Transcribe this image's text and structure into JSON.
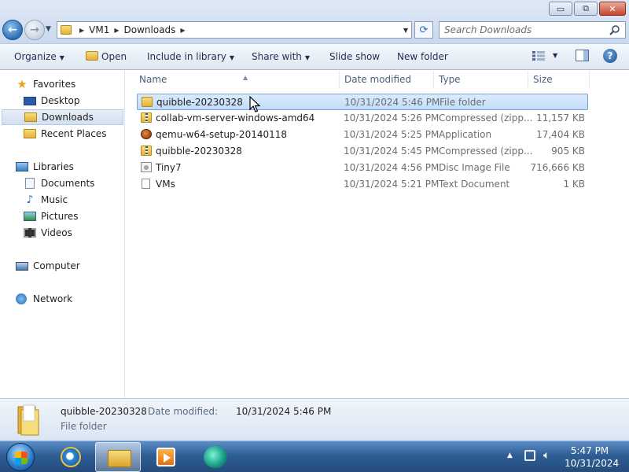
{
  "window": {
    "minimize_label": "▭",
    "maximize_label": "⧉",
    "close_label": "✕"
  },
  "nav": {
    "back_icon": "back-arrow-icon",
    "forward_icon": "forward-arrow-icon"
  },
  "address": {
    "crumbs": [
      "VM1",
      "Downloads"
    ]
  },
  "search": {
    "placeholder": "Search Downloads"
  },
  "toolbar": {
    "organize": "Organize",
    "open": "Open",
    "include_in_library": "Include in library",
    "share_with": "Share with",
    "slide_show": "Slide show",
    "new_folder": "New folder"
  },
  "sidebar": {
    "favorites": "Favorites",
    "desktop": "Desktop",
    "downloads": "Downloads",
    "recent_places": "Recent Places",
    "libraries": "Libraries",
    "documents": "Documents",
    "music": "Music",
    "pictures": "Pictures",
    "videos": "Videos",
    "computer": "Computer",
    "network": "Network"
  },
  "columns": {
    "name": "Name",
    "date_modified": "Date modified",
    "type": "Type",
    "size": "Size"
  },
  "files": [
    {
      "name": "quibble-20230328",
      "date": "10/31/2024 5:46 PM",
      "type": "File folder",
      "size": "",
      "icon": "folder-icon"
    },
    {
      "name": "collab-vm-server-windows-amd64",
      "date": "10/31/2024 5:26 PM",
      "type": "Compressed (zipp...",
      "size": "11,157 KB",
      "icon": "zip-folder-icon"
    },
    {
      "name": "qemu-w64-setup-20140118",
      "date": "10/31/2024 5:25 PM",
      "type": "Application",
      "size": "17,404 KB",
      "icon": "application-icon"
    },
    {
      "name": "quibble-20230328",
      "date": "10/31/2024 5:45 PM",
      "type": "Compressed (zipp...",
      "size": "905 KB",
      "icon": "zip-folder-icon"
    },
    {
      "name": "Tiny7",
      "date": "10/31/2024 4:56 PM",
      "type": "Disc Image File",
      "size": "716,666 KB",
      "icon": "disc-image-icon"
    },
    {
      "name": "VMs",
      "date": "10/31/2024 5:21 PM",
      "type": "Text Document",
      "size": "1 KB",
      "icon": "text-document-icon"
    }
  ],
  "details": {
    "name": "quibble-20230328",
    "modified_label": "Date modified:",
    "modified_value": "10/31/2024 5:46 PM",
    "type": "File folder"
  },
  "taskbar": {
    "time": "5:47 PM",
    "date": "10/31/2024"
  }
}
